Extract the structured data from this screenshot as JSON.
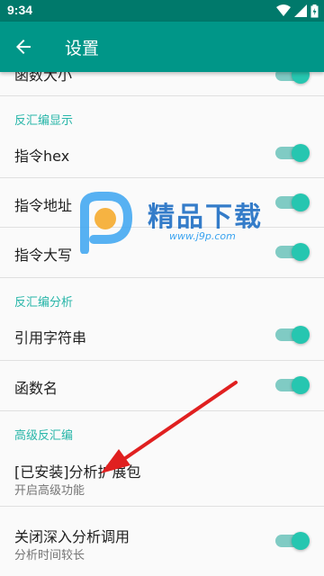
{
  "status_bar": {
    "time": "9:34"
  },
  "app_bar": {
    "title": "设置"
  },
  "settings": {
    "partial_item_label": "函数大小",
    "section_disasm_display": "反汇编显示",
    "opcode_hex": "指令hex",
    "opcode_address": "指令地址",
    "opcode_uppercase": "指令大写",
    "section_disasm_analysis": "反汇编分析",
    "reference_strings": "引用字符串",
    "function_name": "函数名",
    "section_advanced": "高级反汇编",
    "extension_title": "[已安装]分析扩展包",
    "extension_summary": "开启高级功能",
    "disable_deep_title": "关闭深入分析调用",
    "disable_deep_summary": "分析时间较长"
  },
  "watermark": {
    "brand": "精品下载",
    "url": "www.j9p.com"
  },
  "colors": {
    "status_bar": "#00796b",
    "app_bar": "#009688",
    "accent": "#26c6b0",
    "arrow": "#e02020"
  }
}
